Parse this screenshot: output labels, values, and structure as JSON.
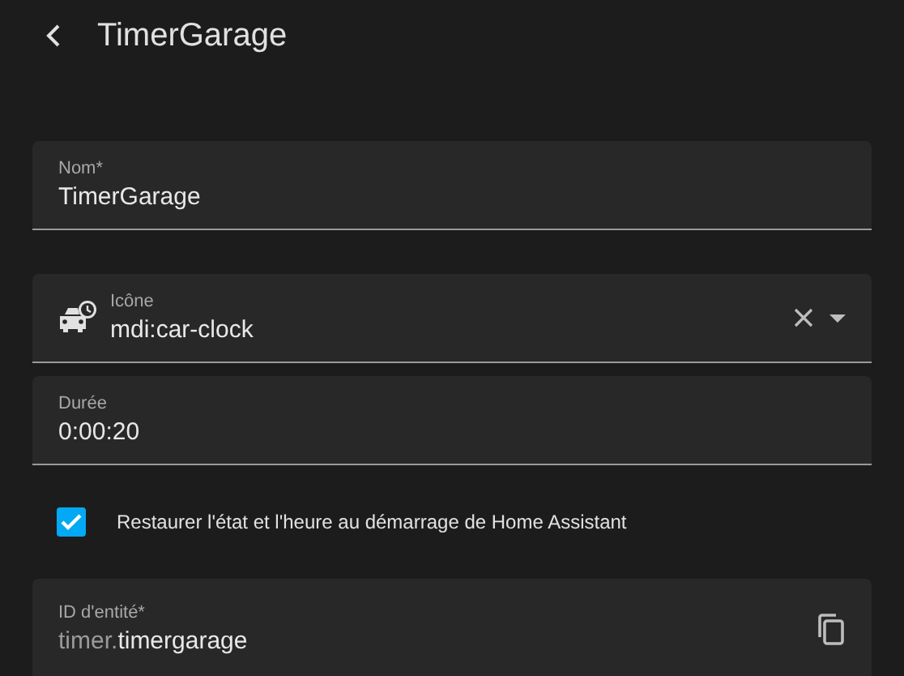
{
  "header": {
    "title": "TimerGarage"
  },
  "name_field": {
    "label": "Nom*",
    "value": "TimerGarage"
  },
  "icon_field": {
    "label": "Icône",
    "value": "mdi:car-clock"
  },
  "duration_field": {
    "label": "Durée",
    "value": "0:00:20"
  },
  "restore_option": {
    "label": "Restaurer l'état et l'heure au démarrage de Home Assistant",
    "checked": true
  },
  "entity_id_field": {
    "label": "ID d'entité*",
    "prefix": "timer.",
    "value": "timergarage"
  }
}
